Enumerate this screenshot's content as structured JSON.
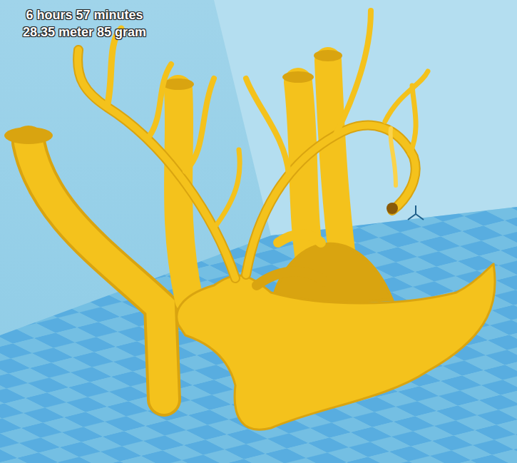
{
  "print_info": {
    "time": "6 hours 57 minutes",
    "material": "28.35 meter 85 gram"
  }
}
